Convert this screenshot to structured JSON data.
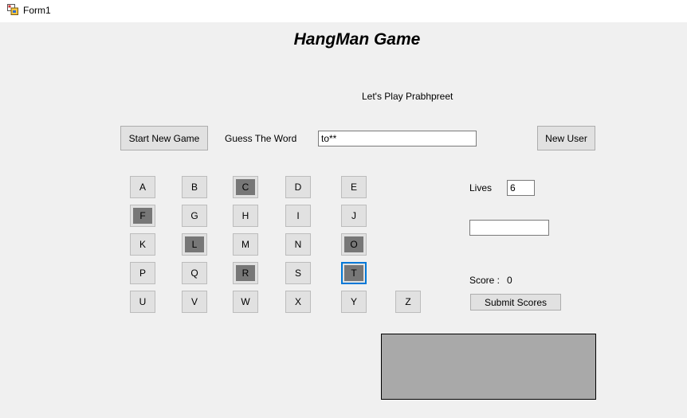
{
  "window": {
    "title": "Form1"
  },
  "heading": "HangMan Game",
  "greeting": "Let's Play Prabhpreet",
  "buttons": {
    "start_new_game": "Start New Game",
    "new_user": "New User",
    "submit_scores": "Submit Scores"
  },
  "guess": {
    "label": "Guess The Word",
    "value": "to**"
  },
  "lives": {
    "label": "Lives",
    "value": "6"
  },
  "extra_input": {
    "value": ""
  },
  "score": {
    "label": "Score :",
    "value": "0"
  },
  "letters": [
    {
      "letter": "A",
      "used": false
    },
    {
      "letter": "B",
      "used": false
    },
    {
      "letter": "C",
      "used": true
    },
    {
      "letter": "D",
      "used": false
    },
    {
      "letter": "E",
      "used": false
    },
    {
      "letter": "F",
      "used": true
    },
    {
      "letter": "G",
      "used": false
    },
    {
      "letter": "H",
      "used": false
    },
    {
      "letter": "I",
      "used": false
    },
    {
      "letter": "J",
      "used": false
    },
    {
      "letter": "K",
      "used": false
    },
    {
      "letter": "L",
      "used": true
    },
    {
      "letter": "M",
      "used": false
    },
    {
      "letter": "N",
      "used": false
    },
    {
      "letter": "O",
      "used": true
    },
    {
      "letter": "P",
      "used": false
    },
    {
      "letter": "Q",
      "used": false
    },
    {
      "letter": "R",
      "used": true
    },
    {
      "letter": "S",
      "used": false
    },
    {
      "letter": "T",
      "used": true,
      "focused": true
    },
    {
      "letter": "U",
      "used": false
    },
    {
      "letter": "V",
      "used": false
    },
    {
      "letter": "W",
      "used": false
    },
    {
      "letter": "X",
      "used": false
    },
    {
      "letter": "Y",
      "used": false
    },
    {
      "letter": "Z",
      "used": false
    }
  ],
  "colors": {
    "used_key": "#777777",
    "focus_border": "#0078d7",
    "canvas": "#a9a9a9",
    "background": "#f0f0f0"
  }
}
